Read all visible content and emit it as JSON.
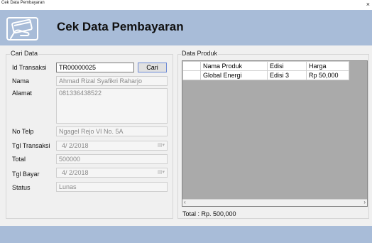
{
  "window": {
    "title": "Cek Data Pembayaran",
    "close_glyph": "×"
  },
  "header": {
    "title": "Cek Data Pembayaran",
    "icon": "payment-card-hand-icon"
  },
  "cari_data": {
    "group_label": "Cari Data",
    "id_transaksi": {
      "label": "Id Transaksi",
      "value": "TR00000025"
    },
    "cari_button": "Cari",
    "nama": {
      "label": "Nama",
      "value": "Ahmad Rizal Syafikri Raharjo"
    },
    "alamat": {
      "label": "Alamat",
      "value": "081336438522"
    },
    "no_telp": {
      "label": "No Telp",
      "value": "Ngagel Rejo VI No. 5A"
    },
    "tgl_transaksi": {
      "label": "Tgl Transaksi",
      "value": "4/  2/2018"
    },
    "total": {
      "label": "Total",
      "value": "500000"
    },
    "tgl_bayar": {
      "label": "Tgl Bayar",
      "value": "4/  2/2018"
    },
    "status": {
      "label": "Status",
      "value": "Lunas"
    }
  },
  "data_produk": {
    "group_label": "Data Produk",
    "columns": [
      "Nama Produk",
      "Edisi",
      "Harga"
    ],
    "rows": [
      [
        "Global Energi",
        "Edisi 3",
        "Rp 50,000"
      ]
    ],
    "total_text": "Total : Rp. 500,000"
  },
  "colors": {
    "banner": "#a8bcd8",
    "grid_bg": "#aaaaaa"
  }
}
